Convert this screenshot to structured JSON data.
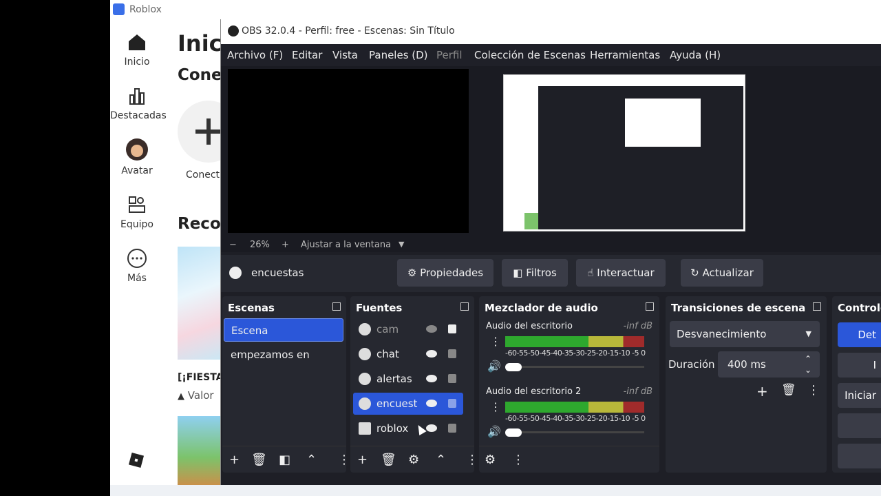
{
  "roblox": {
    "window_title": "Roblox",
    "nav": [
      {
        "label": "Inicio",
        "icon": "home-icon"
      },
      {
        "label": "Destacadas",
        "icon": "chart-icon"
      },
      {
        "label": "Avatar",
        "icon": "avatar-icon"
      },
      {
        "label": "Equipo",
        "icon": "group-icon"
      },
      {
        "label": "Más",
        "icon": "more-icon"
      }
    ],
    "heading": "Inici",
    "subheading": "Cone",
    "connect_label": "Conect",
    "recommended": "Reco",
    "card_title": "[¡FIESTA",
    "card_sub": "Valor"
  },
  "obs": {
    "title": "OBS 32.0.4 - Perfil: free - Escenas: Sin Título",
    "menu": [
      "Archivo (F)",
      "Editar",
      "Vista",
      "Paneles (D)",
      "Perfil",
      "Colección de Escenas",
      "Herramientas",
      "Ayuda (H)"
    ],
    "zoom": {
      "minus": "−",
      "value": "26%",
      "plus": "+",
      "fit": "Ajustar a la ventana"
    },
    "context": {
      "source": "encuestas",
      "buttons": [
        "Propiedades",
        "Filtros",
        "Interactuar",
        "Actualizar"
      ]
    },
    "scenes": {
      "title": "Escenas",
      "items": [
        "Escena",
        "empezamos en"
      ]
    },
    "sources": {
      "title": "Fuentes",
      "items": [
        {
          "name": "cam",
          "visible": false
        },
        {
          "name": "chat",
          "visible": true
        },
        {
          "name": "alertas",
          "visible": true
        },
        {
          "name": "encuest",
          "visible": true
        },
        {
          "name": "roblox",
          "visible": true
        }
      ]
    },
    "mixer": {
      "title": "Mezclador de audio",
      "channels": [
        {
          "name": "Audio del escritorio",
          "db": "-inf dB"
        },
        {
          "name": "Audio del escritorio 2",
          "db": "-inf dB"
        }
      ],
      "scale": "-60-55-50-45-40-35-30-25-20-15-10 -5 0"
    },
    "transitions": {
      "title": "Transiciones de escena",
      "selected": "Desvanecimiento",
      "duration_label": "Duración",
      "duration_value": "400 ms"
    },
    "controls": {
      "title": "Controle",
      "buttons": [
        "Det",
        "I",
        "Iniciar"
      ]
    }
  }
}
